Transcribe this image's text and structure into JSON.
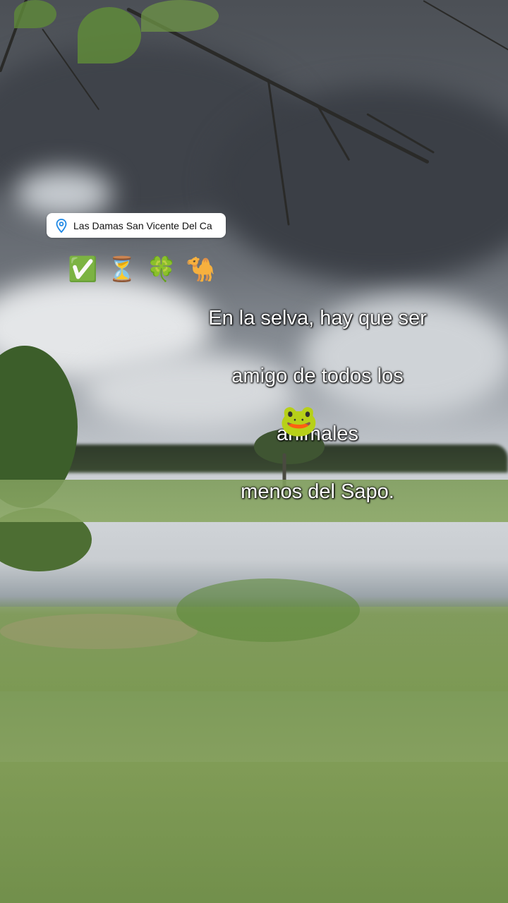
{
  "location_sticker": {
    "icon": "location-pin-icon",
    "text": "Las Damas San Vicente Del Ca"
  },
  "emoji_row": [
    {
      "icon": "check-mark-button-icon",
      "glyph": "✅"
    },
    {
      "icon": "hourglass-icon",
      "glyph": "⏳"
    },
    {
      "icon": "four-leaf-clover-icon",
      "glyph": "🍀"
    },
    {
      "icon": "camel-icon",
      "glyph": "🐪"
    }
  ],
  "caption": {
    "line1": "En la selva, hay que ser",
    "line2": "amigo de todos los",
    "line3": "animales",
    "line4": "menos del Sapo."
  },
  "frog_sticker": {
    "icon": "frog-face-icon",
    "glyph": "🐸"
  },
  "colors": {
    "caption_text": "#ffffff",
    "pin_accent": "#1e88e5"
  }
}
